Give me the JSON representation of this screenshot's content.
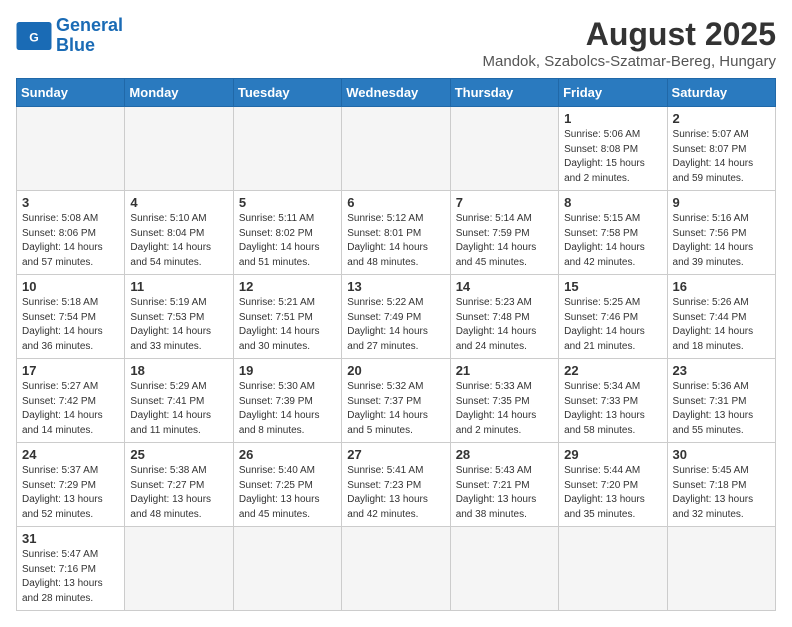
{
  "logo": {
    "text_general": "General",
    "text_blue": "Blue"
  },
  "title": "August 2025",
  "subtitle": "Mandok, Szabolcs-Szatmar-Bereg, Hungary",
  "weekdays": [
    "Sunday",
    "Monday",
    "Tuesday",
    "Wednesday",
    "Thursday",
    "Friday",
    "Saturday"
  ],
  "weeks": [
    [
      {
        "day": "",
        "info": ""
      },
      {
        "day": "",
        "info": ""
      },
      {
        "day": "",
        "info": ""
      },
      {
        "day": "",
        "info": ""
      },
      {
        "day": "",
        "info": ""
      },
      {
        "day": "1",
        "info": "Sunrise: 5:06 AM\nSunset: 8:08 PM\nDaylight: 15 hours and 2 minutes."
      },
      {
        "day": "2",
        "info": "Sunrise: 5:07 AM\nSunset: 8:07 PM\nDaylight: 14 hours and 59 minutes."
      }
    ],
    [
      {
        "day": "3",
        "info": "Sunrise: 5:08 AM\nSunset: 8:06 PM\nDaylight: 14 hours and 57 minutes."
      },
      {
        "day": "4",
        "info": "Sunrise: 5:10 AM\nSunset: 8:04 PM\nDaylight: 14 hours and 54 minutes."
      },
      {
        "day": "5",
        "info": "Sunrise: 5:11 AM\nSunset: 8:02 PM\nDaylight: 14 hours and 51 minutes."
      },
      {
        "day": "6",
        "info": "Sunrise: 5:12 AM\nSunset: 8:01 PM\nDaylight: 14 hours and 48 minutes."
      },
      {
        "day": "7",
        "info": "Sunrise: 5:14 AM\nSunset: 7:59 PM\nDaylight: 14 hours and 45 minutes."
      },
      {
        "day": "8",
        "info": "Sunrise: 5:15 AM\nSunset: 7:58 PM\nDaylight: 14 hours and 42 minutes."
      },
      {
        "day": "9",
        "info": "Sunrise: 5:16 AM\nSunset: 7:56 PM\nDaylight: 14 hours and 39 minutes."
      }
    ],
    [
      {
        "day": "10",
        "info": "Sunrise: 5:18 AM\nSunset: 7:54 PM\nDaylight: 14 hours and 36 minutes."
      },
      {
        "day": "11",
        "info": "Sunrise: 5:19 AM\nSunset: 7:53 PM\nDaylight: 14 hours and 33 minutes."
      },
      {
        "day": "12",
        "info": "Sunrise: 5:21 AM\nSunset: 7:51 PM\nDaylight: 14 hours and 30 minutes."
      },
      {
        "day": "13",
        "info": "Sunrise: 5:22 AM\nSunset: 7:49 PM\nDaylight: 14 hours and 27 minutes."
      },
      {
        "day": "14",
        "info": "Sunrise: 5:23 AM\nSunset: 7:48 PM\nDaylight: 14 hours and 24 minutes."
      },
      {
        "day": "15",
        "info": "Sunrise: 5:25 AM\nSunset: 7:46 PM\nDaylight: 14 hours and 21 minutes."
      },
      {
        "day": "16",
        "info": "Sunrise: 5:26 AM\nSunset: 7:44 PM\nDaylight: 14 hours and 18 minutes."
      }
    ],
    [
      {
        "day": "17",
        "info": "Sunrise: 5:27 AM\nSunset: 7:42 PM\nDaylight: 14 hours and 14 minutes."
      },
      {
        "day": "18",
        "info": "Sunrise: 5:29 AM\nSunset: 7:41 PM\nDaylight: 14 hours and 11 minutes."
      },
      {
        "day": "19",
        "info": "Sunrise: 5:30 AM\nSunset: 7:39 PM\nDaylight: 14 hours and 8 minutes."
      },
      {
        "day": "20",
        "info": "Sunrise: 5:32 AM\nSunset: 7:37 PM\nDaylight: 14 hours and 5 minutes."
      },
      {
        "day": "21",
        "info": "Sunrise: 5:33 AM\nSunset: 7:35 PM\nDaylight: 14 hours and 2 minutes."
      },
      {
        "day": "22",
        "info": "Sunrise: 5:34 AM\nSunset: 7:33 PM\nDaylight: 13 hours and 58 minutes."
      },
      {
        "day": "23",
        "info": "Sunrise: 5:36 AM\nSunset: 7:31 PM\nDaylight: 13 hours and 55 minutes."
      }
    ],
    [
      {
        "day": "24",
        "info": "Sunrise: 5:37 AM\nSunset: 7:29 PM\nDaylight: 13 hours and 52 minutes."
      },
      {
        "day": "25",
        "info": "Sunrise: 5:38 AM\nSunset: 7:27 PM\nDaylight: 13 hours and 48 minutes."
      },
      {
        "day": "26",
        "info": "Sunrise: 5:40 AM\nSunset: 7:25 PM\nDaylight: 13 hours and 45 minutes."
      },
      {
        "day": "27",
        "info": "Sunrise: 5:41 AM\nSunset: 7:23 PM\nDaylight: 13 hours and 42 minutes."
      },
      {
        "day": "28",
        "info": "Sunrise: 5:43 AM\nSunset: 7:21 PM\nDaylight: 13 hours and 38 minutes."
      },
      {
        "day": "29",
        "info": "Sunrise: 5:44 AM\nSunset: 7:20 PM\nDaylight: 13 hours and 35 minutes."
      },
      {
        "day": "30",
        "info": "Sunrise: 5:45 AM\nSunset: 7:18 PM\nDaylight: 13 hours and 32 minutes."
      }
    ],
    [
      {
        "day": "31",
        "info": "Sunrise: 5:47 AM\nSunset: 7:16 PM\nDaylight: 13 hours and 28 minutes."
      },
      {
        "day": "",
        "info": ""
      },
      {
        "day": "",
        "info": ""
      },
      {
        "day": "",
        "info": ""
      },
      {
        "day": "",
        "info": ""
      },
      {
        "day": "",
        "info": ""
      },
      {
        "day": "",
        "info": ""
      }
    ]
  ]
}
